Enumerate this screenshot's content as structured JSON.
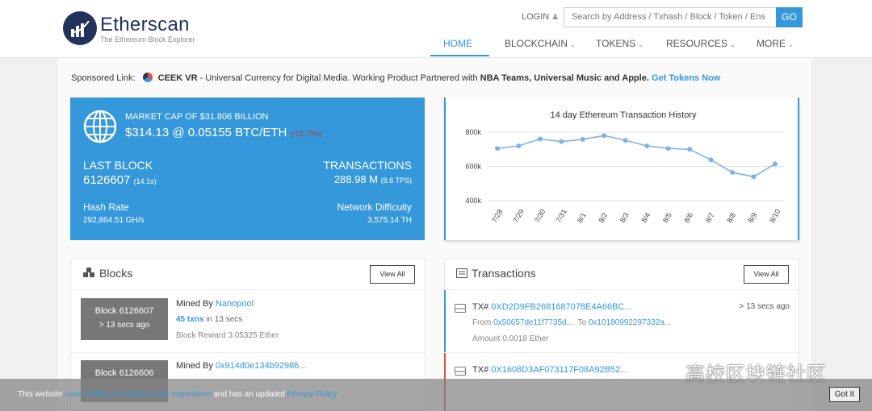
{
  "header": {
    "brand": "Etherscan",
    "brand_sub": "The Ethereum Block Explorer",
    "login": "LOGIN",
    "search_placeholder": "Search by Address / Txhash / Block / Token / Ens",
    "go": "GO",
    "nav": [
      {
        "label": "HOME",
        "active": true
      },
      {
        "label": "BLOCKCHAIN"
      },
      {
        "label": "TOKENS"
      },
      {
        "label": "RESOURCES"
      },
      {
        "label": "MORE"
      }
    ]
  },
  "sponsor": {
    "prefix": "Sponsored Link:",
    "name": "CEEK VR",
    "text1": " - Universal Currency for Digital Media. Working Product Partnered with ",
    "partners": "NBA Teams, Universal Music and Apple.",
    "link": "Get Tokens Now"
  },
  "market": {
    "cap_label": "MARKET CAP OF $31.806 BILLION",
    "price": "$314.13 @ 0.05155 BTC/ETH",
    "change": "(-12.73%)",
    "last_block_label": "LAST BLOCK",
    "last_block": "6126607",
    "last_block_time": "(14.1s)",
    "tx_label": "TRANSACTIONS",
    "tx_value": "288.98 M",
    "tx_tps": "(8.6 TPS)",
    "hashrate_label": "Hash Rate",
    "hashrate": "292,864.51 GH/s",
    "difficulty_label": "Network Difficulty",
    "difficulty": "3,575.14 TH"
  },
  "chart_data": {
    "type": "line",
    "title": "14 day Ethereum Transaction History",
    "categories": [
      "7/28",
      "7/29",
      "7/30",
      "7/31",
      "8/1",
      "8/2",
      "8/3",
      "8/4",
      "8/5",
      "8/6",
      "8/7",
      "8/8",
      "8/9",
      "8/10"
    ],
    "values": [
      705000,
      720000,
      760000,
      745000,
      758000,
      780000,
      752000,
      720000,
      705000,
      700000,
      638000,
      565000,
      540000,
      615000
    ],
    "yticks": [
      "400k",
      "600k",
      "800k"
    ],
    "ylim": [
      400000,
      800000
    ],
    "color": "#7fb2e5",
    "grid": true
  },
  "blocks": {
    "title": "Blocks",
    "view_all": "View All",
    "items": [
      {
        "block": "Block 6126607",
        "age": "> 13 secs ago",
        "mined_by": "Mined By",
        "miner": "Nanopool",
        "txns": "45 txns",
        "txns_time": "in 13 secs",
        "reward": "Block Reward 3.05325 Ether"
      },
      {
        "block": "Block 6126606",
        "age": "",
        "mined_by": "Mined By",
        "miner": "0x914d0e134b92986...",
        "txns": "",
        "txns_time": "",
        "reward": ""
      }
    ]
  },
  "transactions": {
    "title": "Transactions",
    "view_all": "View All",
    "items": [
      {
        "tx_prefix": "TX#",
        "hash": "0XD2D9FB2681687078E4A66BC...",
        "age": "> 13 secs ago",
        "from_label": "From",
        "from": "0x50657de11f7735d...",
        "to_label": "To",
        "to": "0x10180992297332a...",
        "amount": "Amount 0.0018 Ether"
      },
      {
        "tx_prefix": "TX#",
        "hash": "0X1608D3AF073117F08A92B52...",
        "age": "",
        "from_label": "",
        "from": "",
        "to_label": "",
        "to": "",
        "amount": ""
      }
    ]
  },
  "watermark": "高校区块链社区",
  "cookie": {
    "text1": "This website ",
    "link1": "uses cookies to improve your experience",
    "text2": " and has an updated ",
    "link2": "Privacy Policy",
    "text3": ".",
    "button": "Got It"
  }
}
